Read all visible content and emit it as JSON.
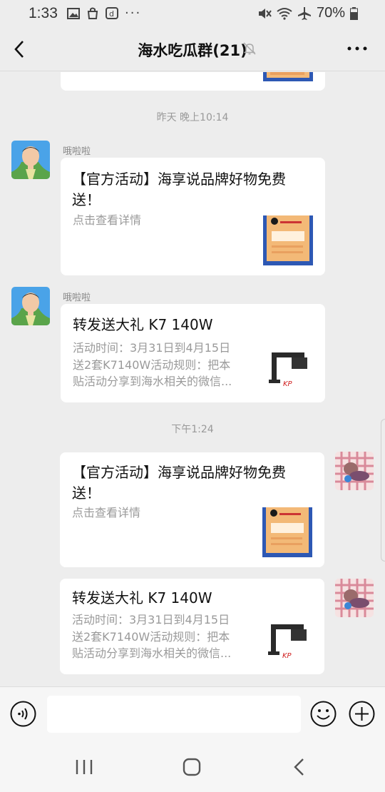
{
  "status_bar": {
    "time": "1:33",
    "battery": "70%"
  },
  "header": {
    "title": "海水吃瓜群(21)"
  },
  "messages": {
    "timestamp_1": "昨天 晚上10:14",
    "timestamp_2": "下午1:24",
    "msg1": {
      "sender": "哦啦啦",
      "title_line1": "【官方活动】海享说品牌好物免费",
      "title_line2": "送！",
      "desc": "点击查看详情"
    },
    "msg2": {
      "sender": "哦啦啦",
      "title": "转发送大礼 K7 140W",
      "desc_line1": "活动时间：3月31日到4月15日",
      "desc_line2": "送2套K7140W活动规则：把本",
      "desc_line3": "贴活动分享到海水相关的微信..."
    },
    "msg3": {
      "title_line1": "【官方活动】海享说品牌好物免费",
      "title_line2": "送！",
      "desc": "点击查看详情"
    },
    "msg4": {
      "title": "转发送大礼 K7 140W",
      "desc_line1": "活动时间：3月31日到4月15日",
      "desc_line2": "送2套K7140W活动规则：把本",
      "desc_line3": "贴活动分享到海水相关的微信..."
    }
  },
  "input": {
    "value": ""
  },
  "icons": {
    "back": "chevron-left-icon",
    "mute": "bell-off-icon",
    "more": "more-dots-icon",
    "voice": "voice-icon",
    "emoji": "emoji-icon",
    "plus": "plus-icon",
    "nav_recent": "recent-apps-icon",
    "nav_home": "home-icon",
    "nav_back": "nav-back-icon"
  },
  "colors": {
    "background": "#ededed",
    "bubble": "#ffffff",
    "accent_text": "#111111",
    "muted_text": "#9a9a9a"
  }
}
